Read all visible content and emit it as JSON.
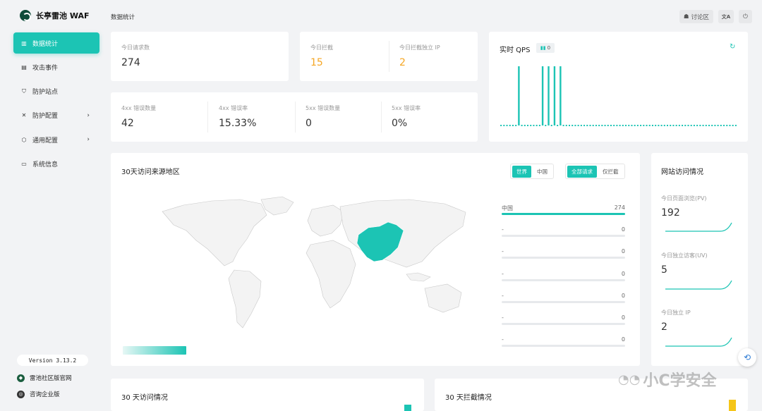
{
  "app": {
    "name": "长亭雷池 WAF"
  },
  "sidebar": {
    "items": [
      {
        "label": "数据统计",
        "icon": "chart-icon"
      },
      {
        "label": "攻击事件",
        "icon": "event-icon"
      },
      {
        "label": "防护站点",
        "icon": "shield-icon"
      },
      {
        "label": "防护配置",
        "icon": "tools-icon"
      },
      {
        "label": "通用配置",
        "icon": "settings-icon"
      },
      {
        "label": "系统信息",
        "icon": "monitor-icon"
      }
    ],
    "version": "Version 3.13.2",
    "community_link": "雷池社区版官网",
    "enterprise_link": "咨询企业版"
  },
  "header": {
    "title": "数据统计",
    "forum_label": "讨论区",
    "lang_label": "文A",
    "logout_icon": "logout-icon"
  },
  "stats": {
    "requests_label": "今日请求数",
    "requests_value": "274",
    "blocked_label": "今日拦截",
    "blocked_value": "15",
    "blocked_ip_label": "今日拦截独立 IP",
    "blocked_ip_value": "2",
    "e4xx_count_label": "4xx 错误数量",
    "e4xx_count_value": "42",
    "e4xx_rate_label": "4xx 错误率",
    "e4xx_rate_value": "15.33%",
    "e5xx_count_label": "5xx 错误数量",
    "e5xx_count_value": "0",
    "e5xx_rate_label": "5xx 错误率",
    "e5xx_rate_value": "0%"
  },
  "qps": {
    "title": "实时 QPS",
    "badge_value": "0",
    "accent": "#1cc4b4"
  },
  "chart_data": {
    "type": "bar",
    "title": "实时 QPS",
    "values": [
      0,
      0,
      0,
      0,
      0,
      0,
      1,
      0,
      0,
      0,
      0,
      0,
      0,
      0,
      1,
      0,
      1,
      0,
      1,
      0,
      1,
      0,
      0,
      0,
      0,
      0,
      0,
      0,
      0,
      0,
      0,
      0,
      0,
      0,
      0,
      0,
      0,
      0,
      0,
      0,
      0,
      0,
      0,
      0,
      0,
      0,
      0,
      0,
      0,
      0,
      0,
      0,
      0,
      0,
      0,
      0,
      0,
      0,
      0,
      0,
      0,
      0,
      0,
      0,
      0,
      0,
      0,
      0,
      0,
      0,
      0,
      0,
      0,
      0,
      0,
      0,
      0,
      0,
      0,
      0
    ],
    "grid": false
  },
  "region": {
    "title": "30天访问来源地区",
    "toggle_world": "世界",
    "toggle_china": "中国",
    "toggle_all": "全部请求",
    "toggle_blocked": "仅拦截",
    "rows": [
      {
        "name": "中国",
        "count": "274",
        "fraction": 1.0
      },
      {
        "name": "-",
        "count": "0",
        "fraction": 0
      },
      {
        "name": "-",
        "count": "0",
        "fraction": 0
      },
      {
        "name": "-",
        "count": "0",
        "fraction": 0
      },
      {
        "name": "-",
        "count": "0",
        "fraction": 0
      },
      {
        "name": "-",
        "count": "0",
        "fraction": 0
      },
      {
        "name": "-",
        "count": "0",
        "fraction": 0
      }
    ],
    "highlight_color": "#1cc4b4"
  },
  "visits": {
    "title": "网站访问情况",
    "pv_label": "今日页面浏览(PV)",
    "pv_value": "192",
    "uv_label": "今日独立访客(UV)",
    "uv_value": "5",
    "ip_label": "今日独立 IP",
    "ip_value": "2"
  },
  "bottom": {
    "visits_30_title": "30 天访问情况",
    "blocked_30_title": "30 天拦截情况"
  },
  "watermark": "小C学安全"
}
